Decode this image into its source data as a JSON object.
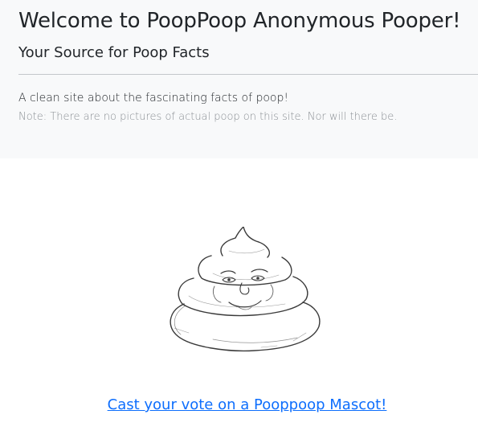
{
  "hero": {
    "title": "Welcome to PoopPoop Anonymous Pooper!",
    "subtitle": "Your Source for Poop Facts",
    "lead": "A clean site about the fascinating facts of poop!",
    "note": "Note: There are no pictures of actual poop on this site. Nor will there be."
  },
  "mascot": {
    "icon": "poop-mascot-sketch"
  },
  "vote": {
    "link_label": "Cast your vote on a Pooppoop Mascot!"
  },
  "colors": {
    "hero_background": "#f8f9fa",
    "link": "#0d6efd",
    "muted_text": "#8a8f94"
  }
}
